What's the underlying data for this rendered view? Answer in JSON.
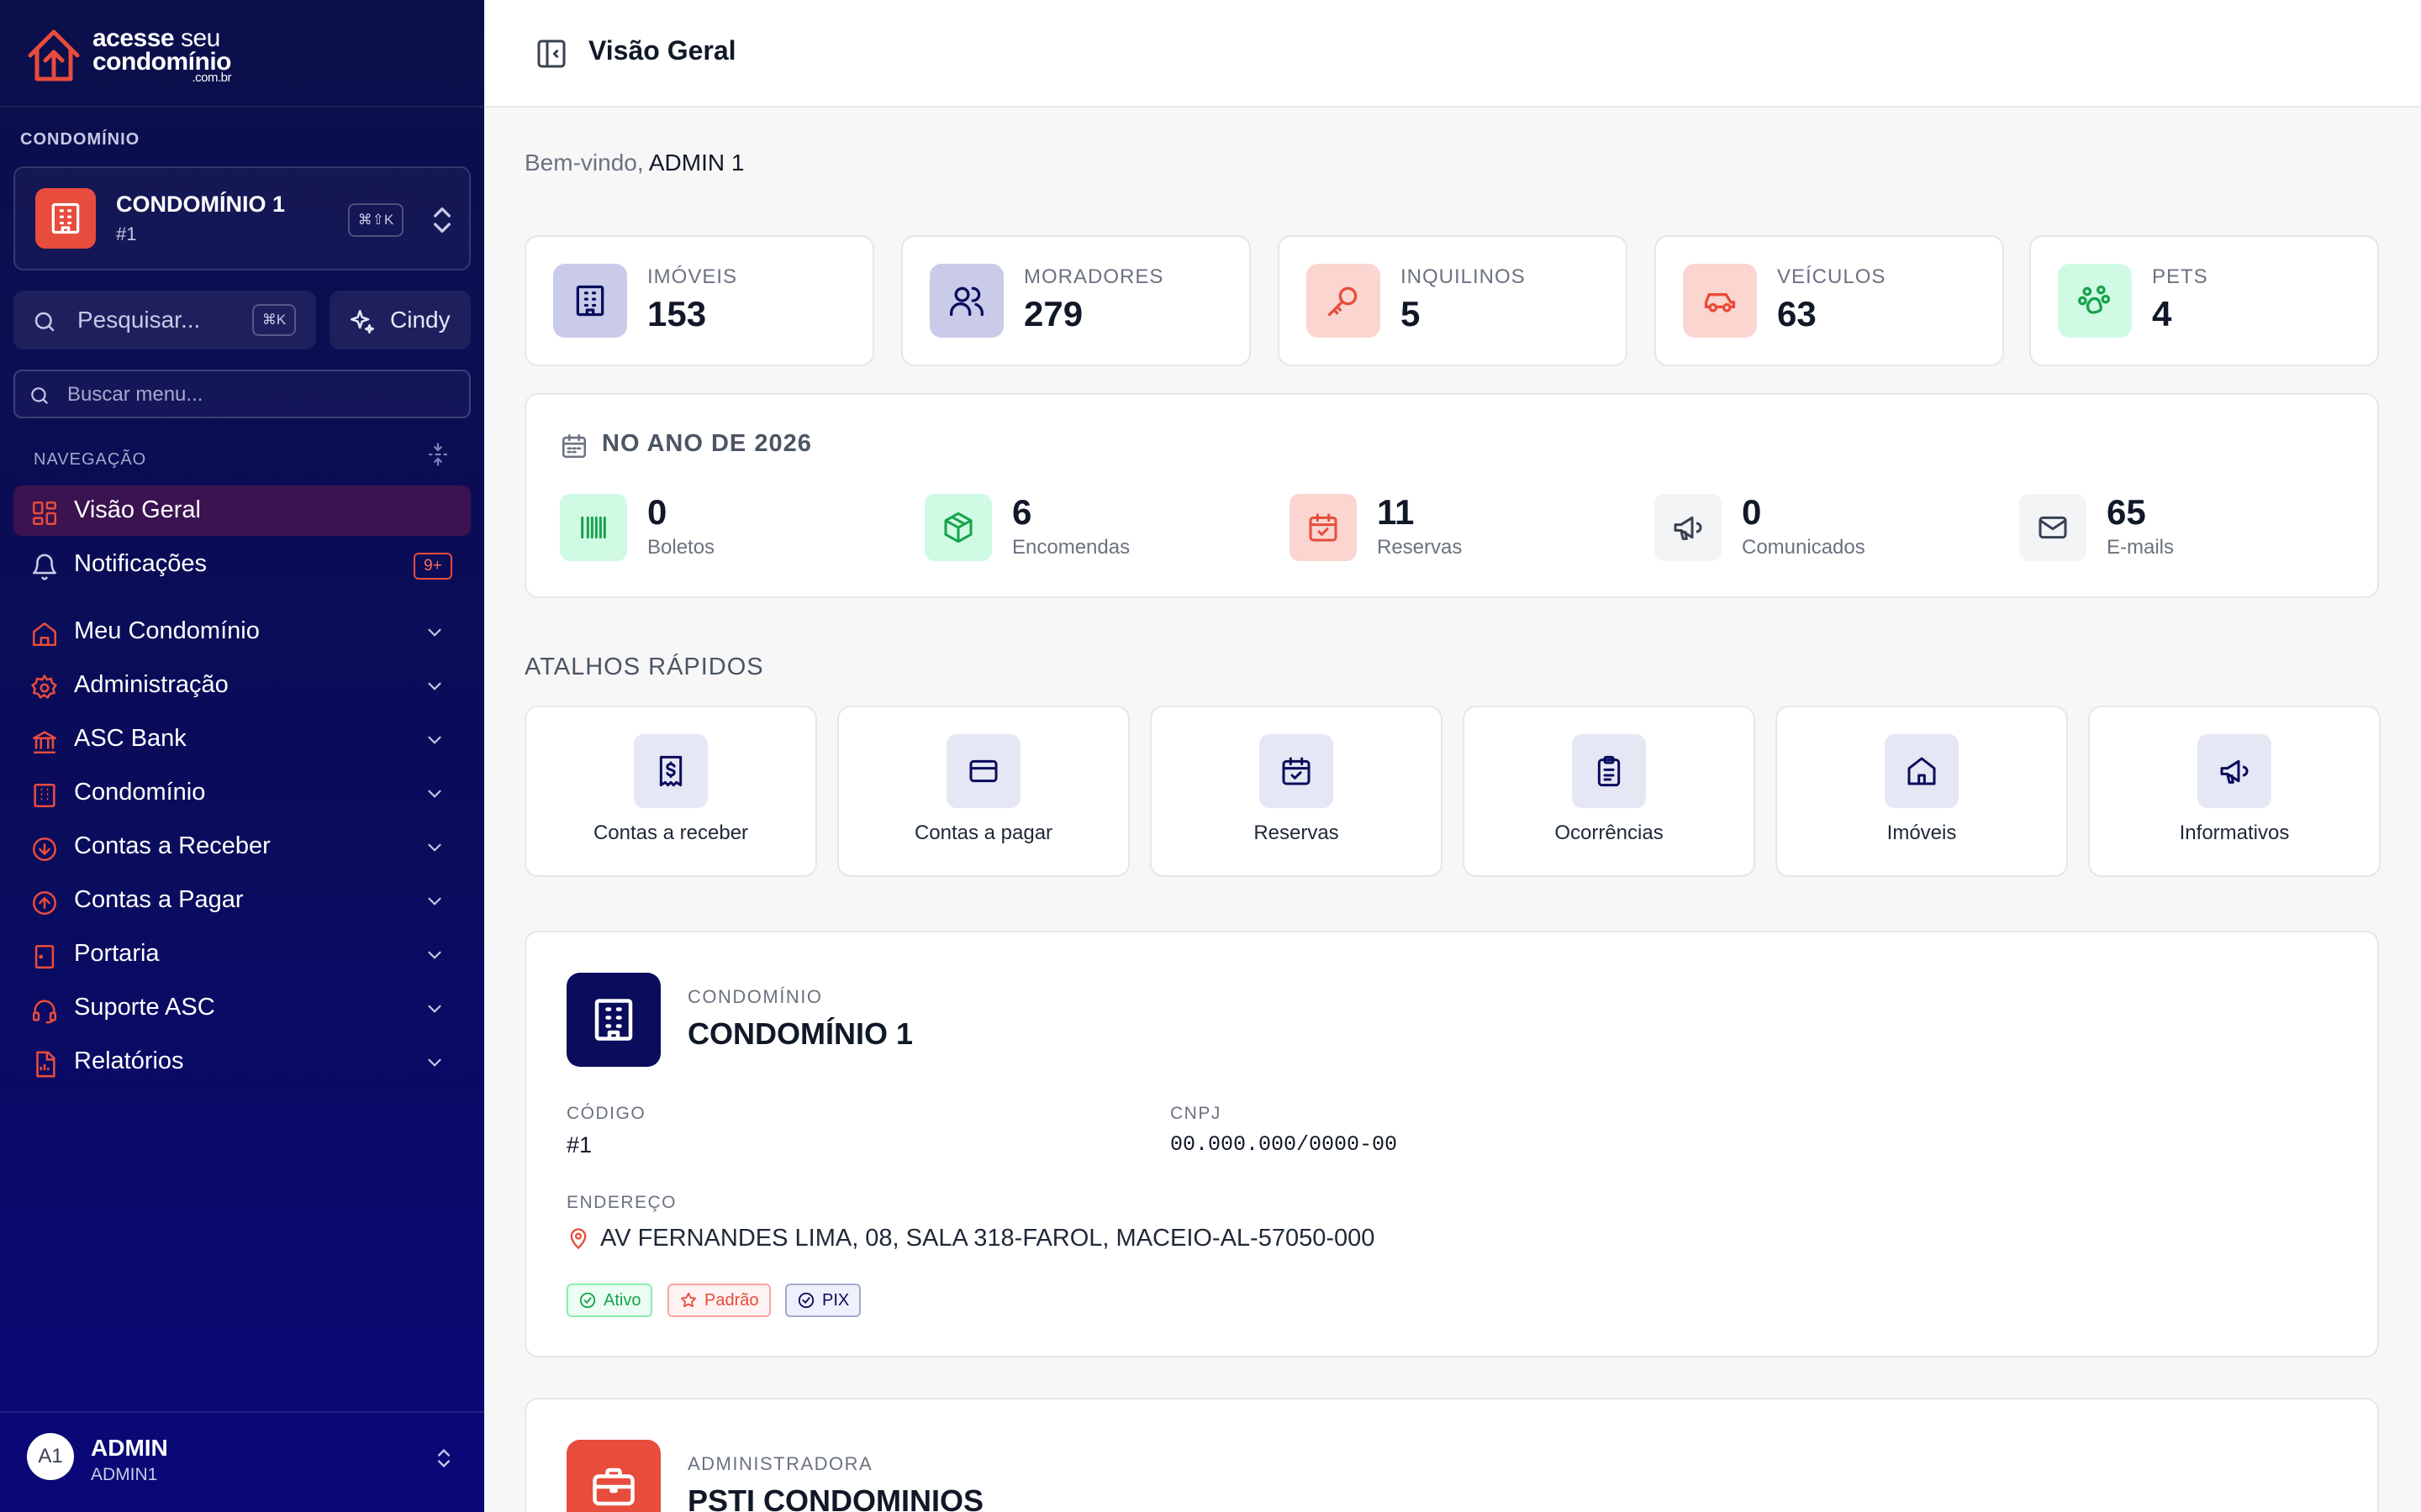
{
  "brand": {
    "line1_bold": "acesse",
    "line1_light": "seu",
    "line2": "condomínio",
    "tld": ".com.br",
    "accent": "#e74c3c",
    "navy": "#0a0c5c"
  },
  "sidebar": {
    "condo_label": "CONDOMÍNIO",
    "condo_selector": {
      "name": "CONDOMÍNIO 1",
      "sub": "#1",
      "shortcut": "⌘⇧K"
    },
    "search": {
      "label": "Pesquisar...",
      "shortcut": "⌘K"
    },
    "assistant": {
      "label": "Cindy"
    },
    "menu_search": {
      "placeholder": "Buscar menu..."
    },
    "nav_label": "NAVEGAÇÃO",
    "items": [
      {
        "label": "Visão Geral",
        "icon": "grid-icon"
      },
      {
        "label": "Notificações",
        "icon": "bell-icon",
        "badge": "9+"
      },
      {
        "label": "Meu Condomínio",
        "icon": "home-icon"
      },
      {
        "label": "Administração",
        "icon": "gear-icon"
      },
      {
        "label": "ASC Bank",
        "icon": "bank-icon"
      },
      {
        "label": "Condomínio",
        "icon": "building-icon"
      },
      {
        "label": "Contas a Receber",
        "icon": "arrow-down-circle-icon"
      },
      {
        "label": "Contas a Pagar",
        "icon": "arrow-up-circle-icon"
      },
      {
        "label": "Portaria",
        "icon": "door-icon"
      },
      {
        "label": "Suporte ASC",
        "icon": "headset-icon"
      },
      {
        "label": "Relatórios",
        "icon": "report-icon"
      }
    ],
    "user": {
      "initials": "A1",
      "name": "ADMIN",
      "sub": "ADMIN1"
    }
  },
  "header": {
    "title": "Visão Geral"
  },
  "welcome": {
    "prefix": "Bem-vindo,",
    "name": "ADMIN 1"
  },
  "stats": [
    {
      "label": "IMÓVEIS",
      "value": "153",
      "icon": "building-icon"
    },
    {
      "label": "MORADORES",
      "value": "279",
      "icon": "users-icon"
    },
    {
      "label": "INQUILINOS",
      "value": "5",
      "icon": "key-icon"
    },
    {
      "label": "VEÍCULOS",
      "value": "63",
      "icon": "car-icon"
    },
    {
      "label": "PETS",
      "value": "4",
      "icon": "paw-icon"
    }
  ],
  "year": {
    "title": "NO ANO DE 2026",
    "items": [
      {
        "value": "0",
        "label": "Boletos",
        "icon": "barcode-icon"
      },
      {
        "value": "6",
        "label": "Encomendas",
        "icon": "package-icon"
      },
      {
        "value": "11",
        "label": "Reservas",
        "icon": "calendar-check-icon"
      },
      {
        "value": "0",
        "label": "Comunicados",
        "icon": "megaphone-icon"
      },
      {
        "value": "65",
        "label": "E-mails",
        "icon": "mail-icon"
      }
    ]
  },
  "shortcuts": {
    "title": "ATALHOS RÁPIDOS",
    "items": [
      {
        "label": "Contas a receber",
        "icon": "receipt-dollar-icon"
      },
      {
        "label": "Contas a pagar",
        "icon": "credit-card-icon"
      },
      {
        "label": "Reservas",
        "icon": "calendar-check-icon"
      },
      {
        "label": "Ocorrências",
        "icon": "clipboard-icon"
      },
      {
        "label": "Imóveis",
        "icon": "home-icon"
      },
      {
        "label": "Informativos",
        "icon": "megaphone-icon"
      }
    ]
  },
  "condo": {
    "kicker": "CONDOMÍNIO",
    "name": "CONDOMÍNIO 1",
    "codigo_label": "CÓDIGO",
    "codigo": "#1",
    "cnpj_label": "CNPJ",
    "cnpj": "00.000.000/0000-00",
    "endereco_label": "ENDEREÇO",
    "endereco": "AV FERNANDES LIMA, 08, SALA 318-FAROL, MACEIO-AL-57050-000",
    "badges": [
      "Ativo",
      "Padrão",
      "PIX"
    ]
  },
  "admin": {
    "kicker": "ADMINISTRADORA",
    "name": "PSTI CONDOMINIOS"
  }
}
